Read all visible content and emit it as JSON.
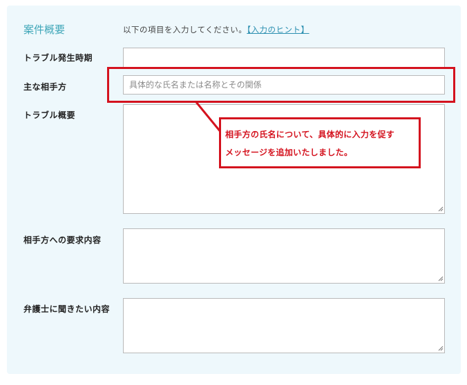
{
  "section": {
    "title": "案件概要",
    "hint_text": "以下の項目を入力してください。",
    "hint_link": "【入力のヒント】"
  },
  "fields": [
    {
      "label": "トラブル発生時期",
      "value": "",
      "placeholder": ""
    },
    {
      "label": "主な相手方",
      "value": "",
      "placeholder": "具体的な氏名または名称とその関係"
    },
    {
      "label": "トラブル概要",
      "value": "",
      "placeholder": ""
    },
    {
      "label": "相手方への要求内容",
      "value": "",
      "placeholder": ""
    },
    {
      "label": "弁護士に聞きたい内容",
      "value": "",
      "placeholder": ""
    }
  ],
  "annotation": {
    "line1": "相手方の氏名について、具体的に入力を促す",
    "line2": "メッセージを追加いたしました。"
  },
  "colors": {
    "panel_bg": "#eef8fc",
    "title": "#3ea6b8",
    "link": "#2b8fb0",
    "annotation": "#d4121e",
    "field_border": "#b9b9b9"
  }
}
